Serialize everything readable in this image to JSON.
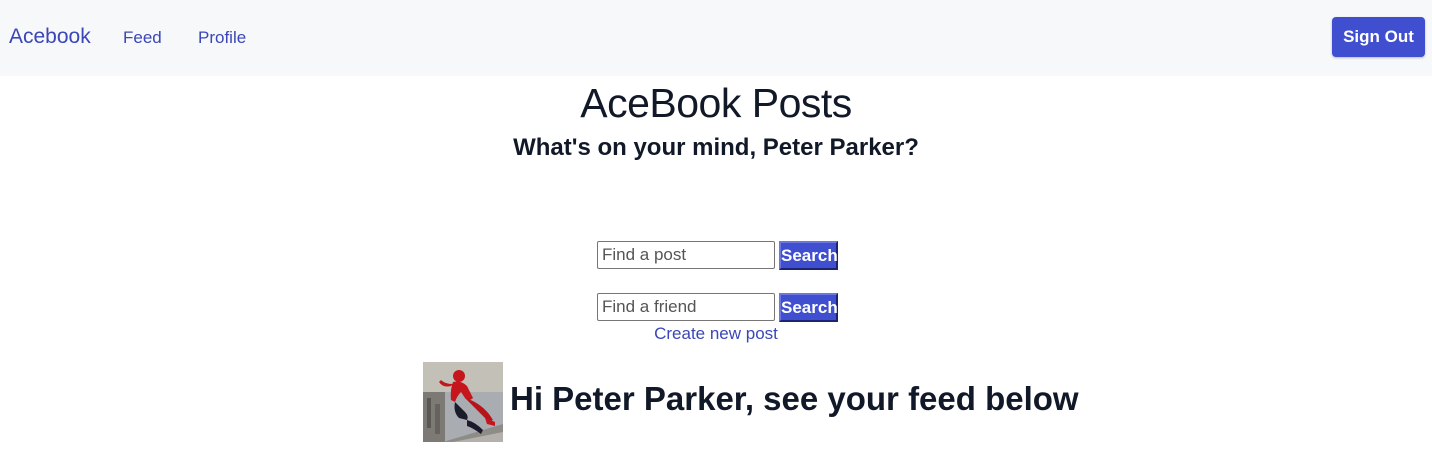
{
  "nav": {
    "brand": "Acebook",
    "links": [
      {
        "label": "Feed"
      },
      {
        "label": "Profile"
      }
    ],
    "signout_label": "Sign Out"
  },
  "main": {
    "title": "AceBook Posts",
    "subtitle": "What's on your mind, Peter Parker?",
    "post_search": {
      "placeholder": "Find a post",
      "value": "",
      "button_label": "Search"
    },
    "friend_search": {
      "placeholder": "Find a friend",
      "value": "",
      "button_label": "Search"
    },
    "create_post_label": "Create new post",
    "feed_heading": "Hi Peter Parker, see your feed below"
  },
  "colors": {
    "accent": "#3f4fd0",
    "link": "#3b46b8",
    "navbar_bg": "#f7f8fa",
    "text": "#111827"
  }
}
